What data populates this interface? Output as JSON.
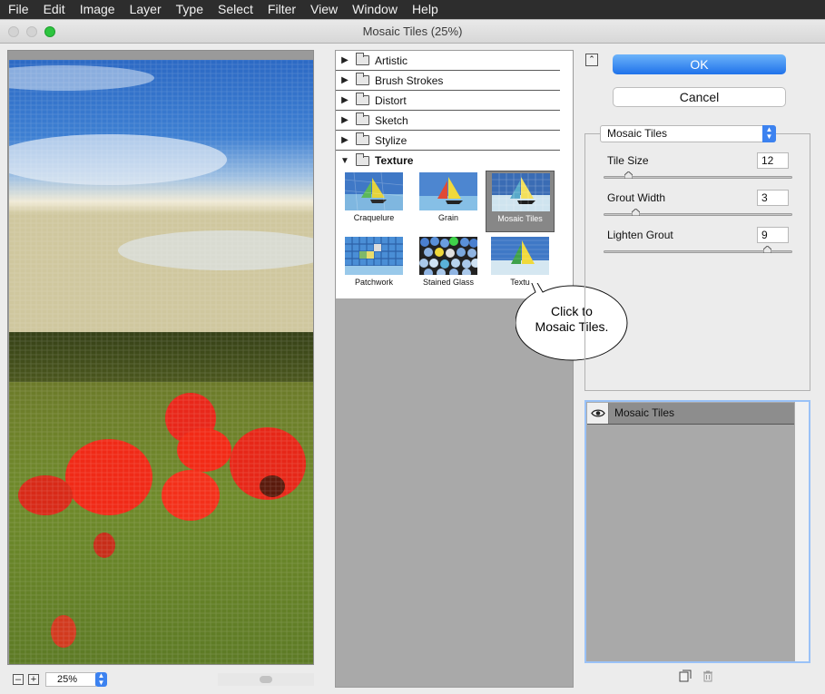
{
  "menubar": {
    "items": [
      "File",
      "Edit",
      "Image",
      "Layer",
      "Type",
      "Select",
      "Filter",
      "View",
      "Window",
      "Help"
    ]
  },
  "window": {
    "title": "Mosaic Tiles (25%)"
  },
  "preview": {
    "zoom_minus": "–",
    "zoom_plus": "+",
    "zoom_value": "25%"
  },
  "browser": {
    "categories": [
      {
        "label": "Artistic",
        "expanded": false
      },
      {
        "label": "Brush Strokes",
        "expanded": false
      },
      {
        "label": "Distort",
        "expanded": false
      },
      {
        "label": "Sketch",
        "expanded": false
      },
      {
        "label": "Stylize",
        "expanded": false
      },
      {
        "label": "Texture",
        "expanded": true
      }
    ],
    "thumbnails": [
      {
        "label": "Craquelure",
        "selected": false
      },
      {
        "label": "Grain",
        "selected": false
      },
      {
        "label": "Mosaic Tiles",
        "selected": true
      },
      {
        "label": "Patchwork",
        "selected": false
      },
      {
        "label": "Stained Glass",
        "selected": false
      },
      {
        "label": "Textu",
        "selected": false
      }
    ]
  },
  "callout": {
    "line1": "Click to",
    "line2": "Mosaic Tiles."
  },
  "buttons": {
    "ok": "OK",
    "cancel": "Cancel"
  },
  "settings": {
    "filter_select": "Mosaic Tiles",
    "params": [
      {
        "label": "Tile Size",
        "value": "12",
        "level_percent": 11
      },
      {
        "label": "Grout Width",
        "value": "3",
        "level_percent": 15
      },
      {
        "label": "Lighten Grout",
        "value": "9",
        "level_percent": 88
      }
    ]
  },
  "layers": {
    "items": [
      {
        "label": "Mosaic Tiles",
        "visible": true
      }
    ]
  },
  "colors": {
    "accent_blue": "#1f72ea",
    "selected_thumb": "#878787",
    "panel_gray": "#a9a9a9",
    "focus_ring": "#9ac2f7"
  }
}
